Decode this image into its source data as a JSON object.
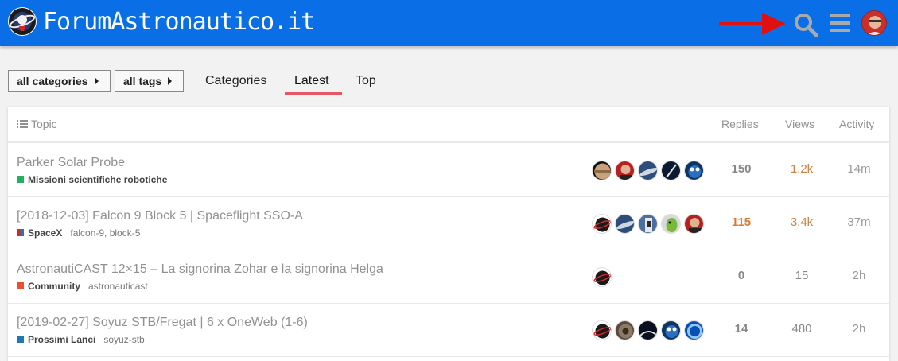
{
  "header": {
    "site_name": "ForumAstronautico.it",
    "logo_icon": "astronaut-logo-icon",
    "search_icon": "search-icon",
    "menu_icon": "hamburger-menu-icon",
    "annotation_arrow": "red-arrow-pointing-search",
    "colors": {
      "bar": "#0a6fe6",
      "arrow": "#e01010"
    }
  },
  "nav": {
    "category_filter": "all categories",
    "tag_filter": "all tags",
    "links": [
      {
        "label": "Categories",
        "active": false
      },
      {
        "label": "Latest",
        "active": true
      },
      {
        "label": "Top",
        "active": false
      }
    ]
  },
  "table": {
    "columns": {
      "topic": "Topic",
      "replies": "Replies",
      "views": "Views",
      "activity": "Activity"
    },
    "rows": [
      {
        "title": "Parker Solar Probe",
        "category": "Missioni scientifiche robotiche",
        "category_color": "#27ae60",
        "tags": "",
        "replies": "150",
        "views": "1.2k",
        "activity": "14m"
      },
      {
        "title": "[2018-12-03] Falcon 9 Block 5 | Spaceflight SSO-A",
        "category": "SpaceX",
        "category_color": "split-red-blue",
        "tags": "falcon-9, block-5",
        "replies": "115",
        "views": "3.4k",
        "activity": "37m"
      },
      {
        "title": "AstronautiCAST 12×15 – La signorina Zohar e la signorina Helga",
        "category": "Community",
        "category_color": "#e8502f",
        "tags": "astronauticast",
        "replies": "0",
        "views": "15",
        "activity": "2h"
      },
      {
        "title": "[2019-02-27] Soyuz STB/Fregat | 6 x OneWeb (1-6)",
        "category": "Prossimi Lanci",
        "category_color": "#1f77b4",
        "tags": "soyuz-stb",
        "replies": "14",
        "views": "480",
        "activity": "2h"
      }
    ]
  }
}
